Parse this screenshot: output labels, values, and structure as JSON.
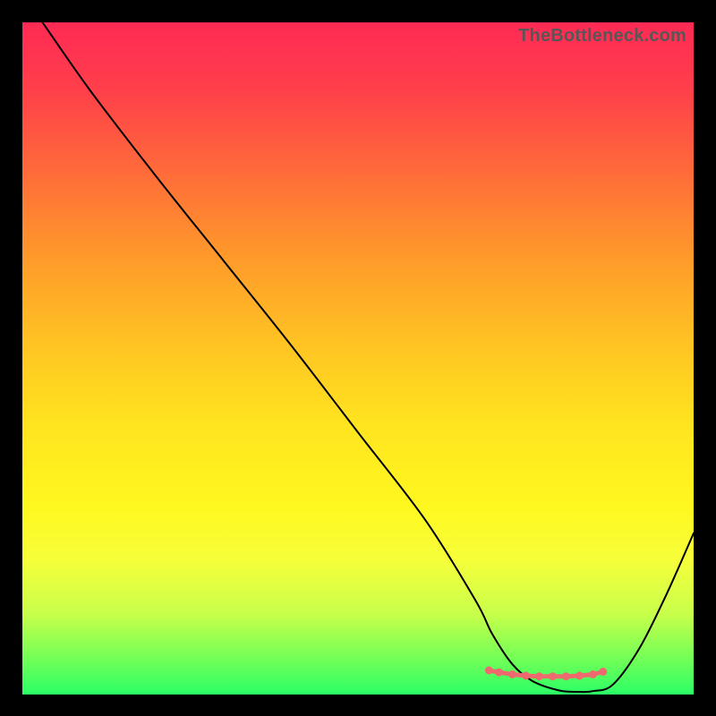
{
  "watermark": "TheBottleneck.com",
  "colors": {
    "curve_stroke": "#000000",
    "marker_stroke": "#ee6a6f",
    "marker_fill": "#ee6a6f"
  },
  "chart_data": {
    "type": "line",
    "title": "",
    "xlabel": "",
    "ylabel": "",
    "xlim": [
      0,
      100
    ],
    "ylim": [
      0,
      100
    ],
    "series": [
      {
        "name": "bottleneck-curve",
        "x": [
          3,
          10,
          20,
          30,
          40,
          50,
          60,
          67.5,
          70,
          73,
          76,
          80,
          83,
          85,
          88,
          92,
          96,
          100
        ],
        "values": [
          100,
          90,
          77,
          64.5,
          52,
          39,
          26,
          14,
          9,
          4.5,
          2,
          0.6,
          0.4,
          0.5,
          1.5,
          7,
          15,
          24
        ]
      }
    ],
    "markers": {
      "name": "optimal-range",
      "x": [
        69.5,
        71,
        73,
        75,
        77,
        79,
        81,
        83,
        85,
        86.5
      ],
      "values": [
        3.6,
        3.3,
        3.0,
        2.8,
        2.7,
        2.7,
        2.7,
        2.8,
        3.0,
        3.4
      ],
      "radius_px": 4.5
    }
  }
}
